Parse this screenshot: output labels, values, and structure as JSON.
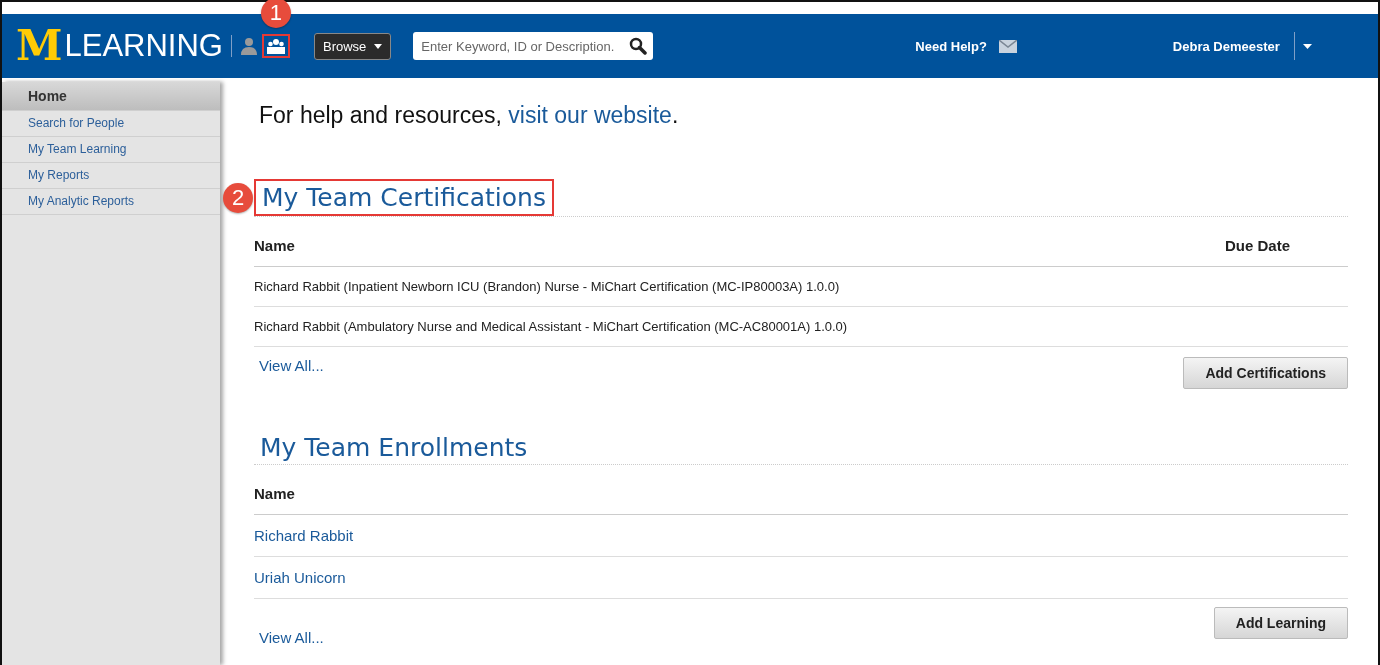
{
  "header": {
    "logo_mark": "M",
    "logo_text": "LEARNING",
    "browse_button": "Browse",
    "search": {
      "placeholder": "Enter Keyword, ID or Description."
    },
    "help_link": "Need Help?",
    "user_name": "Debra Demeester"
  },
  "sidebar": {
    "items": [
      {
        "label": "Home",
        "selected": true
      },
      {
        "label": "Search for People",
        "selected": false
      },
      {
        "label": "My Team Learning",
        "selected": false
      },
      {
        "label": "My Reports",
        "selected": false
      },
      {
        "label": "My Analytic Reports",
        "selected": false
      }
    ]
  },
  "intro": {
    "text": "For help and resources, ",
    "link": "visit our website",
    "end": "."
  },
  "certifications": {
    "title": "My Team Certifications",
    "columns": [
      "Name",
      "Due Date"
    ],
    "rows": [
      {
        "name": "Richard Rabbit (Inpatient Newborn ICU (Brandon) Nurse - MiChart Certification (MC-IP80003A) 1.0.0)"
      },
      {
        "name": "Richard Rabbit (Ambulatory Nurse and Medical Assistant - MiChart Certification (MC-AC80001A) 1.0.0)"
      }
    ],
    "view_all": "View All...",
    "add_button": "Add Certifications"
  },
  "enrollments": {
    "title": "My Team Enrollments",
    "columns": [
      "Name"
    ],
    "rows": [
      {
        "name": "Richard Rabbit"
      },
      {
        "name": "Uriah Unicorn"
      }
    ],
    "view_all": "View All...",
    "add_button": "Add Learning"
  },
  "callouts": [
    {
      "number": "1"
    },
    {
      "number": "2"
    }
  ]
}
